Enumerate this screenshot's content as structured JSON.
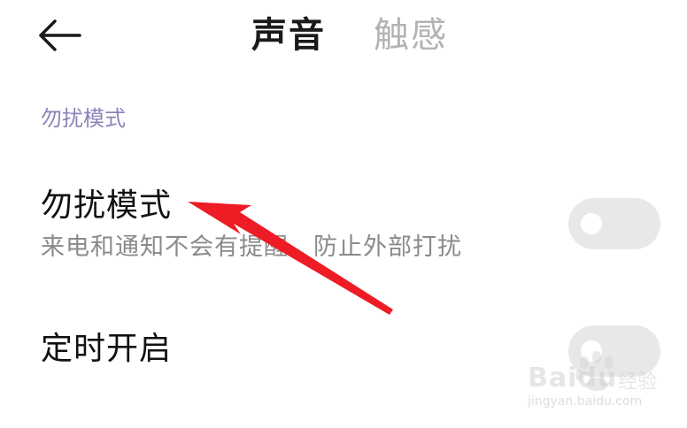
{
  "header": {
    "back_icon": "arrow-left-icon",
    "tabs": [
      {
        "label": "声音",
        "active": true
      },
      {
        "label": "触感",
        "active": false
      }
    ]
  },
  "section": {
    "header": "勿扰模式"
  },
  "settings": [
    {
      "title": "勿扰模式",
      "subtitle": "来电和通知不会有提醒，防止外部打扰",
      "enabled": false
    },
    {
      "title": "定时开启",
      "enabled": false
    }
  ],
  "colors": {
    "annotation_arrow": "#ee1c24",
    "section_header": "#8c84b8",
    "toggle_off": "#e8e8e8"
  },
  "watermark": {
    "brand": "Baidu",
    "brand_cn": "经验",
    "url": "jingyan.baidu.com"
  }
}
